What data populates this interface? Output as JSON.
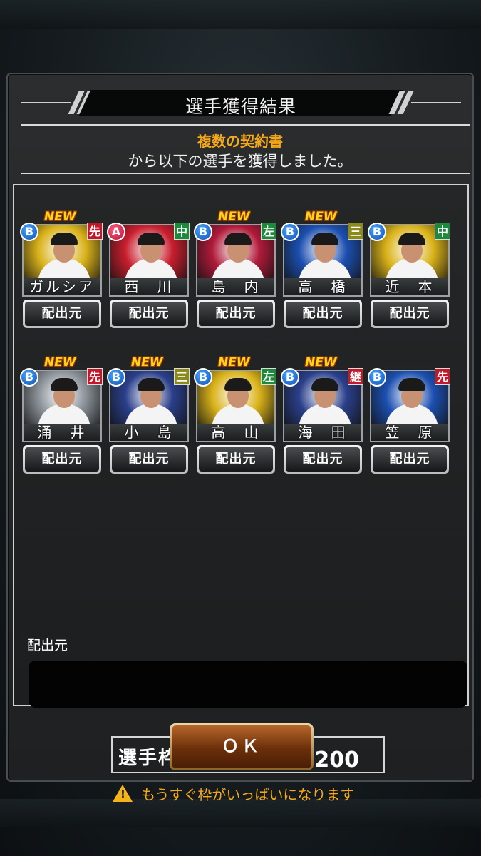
{
  "dialog": {
    "title": "選手獲得結果",
    "source_name": "複数の契約書",
    "description": "から以下の選手を獲得しました。"
  },
  "players": [
    {
      "name": "ガルシア",
      "rank": "B",
      "position": "先",
      "position_color": "#c4182a",
      "is_new": true,
      "new_label": "NEW",
      "source_button": "配出元",
      "bg": "#d9b21a"
    },
    {
      "name": "西　川",
      "rank": "A",
      "position": "中",
      "position_color": "#1b8a3a",
      "is_new": false,
      "new_label": "",
      "source_button": "配出元",
      "bg": "#c81e2e"
    },
    {
      "name": "島　内",
      "rank": "B",
      "position": "左",
      "position_color": "#1b8a3a",
      "is_new": true,
      "new_label": "NEW",
      "source_button": "配出元",
      "bg": "#b01a3a"
    },
    {
      "name": "高　橋",
      "rank": "B",
      "position": "三",
      "position_color": "#8d8a1c",
      "is_new": true,
      "new_label": "NEW",
      "source_button": "配出元",
      "bg": "#1c4fb0"
    },
    {
      "name": "近　本",
      "rank": "B",
      "position": "中",
      "position_color": "#1b8a3a",
      "is_new": false,
      "new_label": "",
      "source_button": "配出元",
      "bg": "#d9b21a"
    },
    {
      "name": "涌　井",
      "rank": "B",
      "position": "先",
      "position_color": "#c4182a",
      "is_new": true,
      "new_label": "NEW",
      "source_button": "配出元",
      "bg": "#8a9198"
    },
    {
      "name": "小　島",
      "rank": "B",
      "position": "三",
      "position_color": "#8d8a1c",
      "is_new": true,
      "new_label": "NEW",
      "source_button": "配出元",
      "bg": "#2a3f8a"
    },
    {
      "name": "高　山",
      "rank": "B",
      "position": "左",
      "position_color": "#1b8a3a",
      "is_new": true,
      "new_label": "NEW",
      "source_button": "配出元",
      "bg": "#d9b21a"
    },
    {
      "name": "海　田",
      "rank": "B",
      "position": "継",
      "position_color": "#c4182a",
      "is_new": true,
      "new_label": "NEW",
      "source_button": "配出元",
      "bg": "#2a3f8a"
    },
    {
      "name": "笠　原",
      "rank": "B",
      "position": "先",
      "position_color": "#c4182a",
      "is_new": false,
      "new_label": "",
      "source_button": "配出元",
      "bg": "#1c4fb0"
    }
  ],
  "source_section": {
    "label": "配出元",
    "value": ""
  },
  "roster": {
    "label": "選手枠：",
    "count": "193／200"
  },
  "warning": {
    "icon": "warning-triangle-icon",
    "text": "もうすぐ枠がいっぱいになります"
  },
  "ok_button": {
    "label": "ＯＫ"
  }
}
